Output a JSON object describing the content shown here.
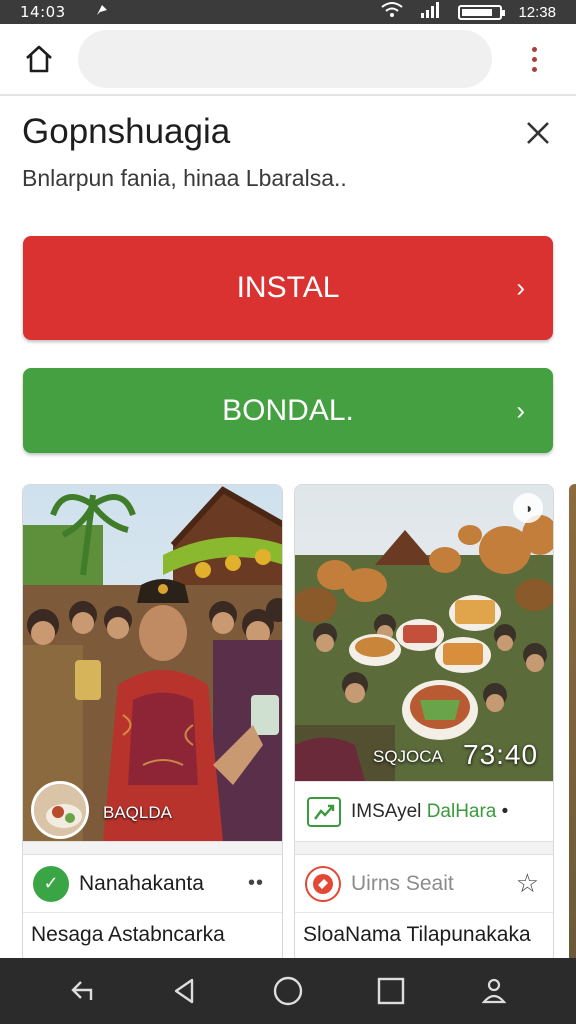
{
  "status_bar": {
    "time_left": "14:03",
    "time_right": "12:38",
    "icons": [
      "notification-icon",
      "wifi-icon",
      "signal-icon",
      "battery-icon"
    ]
  },
  "browser": {
    "url_placeholder": "",
    "icons": [
      "home-icon",
      "more-vert-icon"
    ]
  },
  "header": {
    "title": "Gopnshuagia",
    "subtitle": "Bnlarpun fania, hinaa Lbaralsa..",
    "close_icon": "close-icon"
  },
  "buttons": {
    "install_label": "INSTAL",
    "download_label": "BONDAL.",
    "chevron": "›"
  },
  "colors": {
    "install": "#d93230",
    "download": "#44a040",
    "accent_green": "#3a9a3c",
    "kebab": "#a6403a"
  },
  "cards": [
    {
      "image_caption": "BAQLDA",
      "app_name": "Nanahakanta",
      "menu": "••",
      "title": "Nesaga Astabncarka"
    },
    {
      "overlay_small": "SQJOCA",
      "overlay_big": "73:40",
      "banner_prefix": "IMSAyel ",
      "banner_green": "DalHara",
      "banner_suffix": " •",
      "app_name": "Uirns Seait",
      "title": "SloaNama Tilapunakaka"
    }
  ],
  "nav": {
    "icons": [
      "back-arrow-icon",
      "back-triangle-icon",
      "home-circle-icon",
      "recents-square-icon",
      "profile-icon"
    ]
  }
}
